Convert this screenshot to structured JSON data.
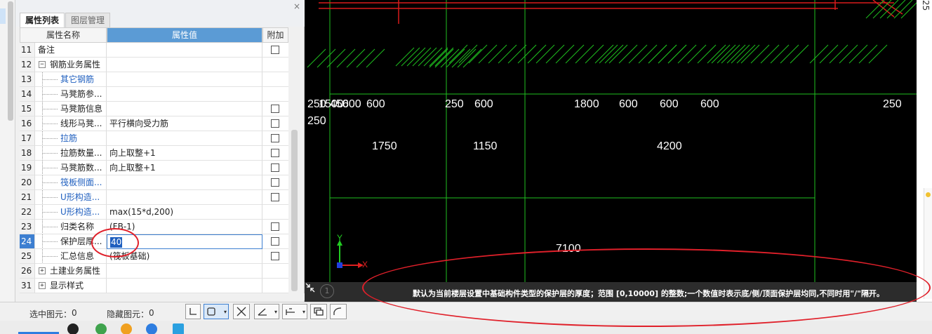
{
  "panel": {
    "close_glyph": "×",
    "tabs": [
      {
        "label": "属性列表",
        "active": true
      },
      {
        "label": "图层管理",
        "active": false
      }
    ],
    "columns": {
      "name": "属性名称",
      "value": "属性值",
      "extra": "附加"
    },
    "rows": [
      {
        "no": "11",
        "name": "备注",
        "value": "",
        "checkbox": true
      },
      {
        "no": "12",
        "name": "钢筋业务属性",
        "value": "",
        "checkbox": false,
        "expander": "−"
      },
      {
        "no": "13",
        "name": "其它钢筋",
        "value": "",
        "checkbox": false,
        "blue": true
      },
      {
        "no": "14",
        "name": "马凳筋参...",
        "value": "",
        "checkbox": false
      },
      {
        "no": "15",
        "name": "马凳筋信息",
        "value": "",
        "checkbox": true
      },
      {
        "no": "16",
        "name": "线形马凳...",
        "value": "平行横向受力筋",
        "checkbox": true
      },
      {
        "no": "17",
        "name": "拉筋",
        "value": "",
        "checkbox": true,
        "blue": true
      },
      {
        "no": "18",
        "name": "拉筋数量...",
        "value": "向上取整+1",
        "checkbox": true
      },
      {
        "no": "19",
        "name": "马凳筋数...",
        "value": "向上取整+1",
        "checkbox": true
      },
      {
        "no": "20",
        "name": "筏板侧面...",
        "value": "",
        "checkbox": true,
        "blue": true
      },
      {
        "no": "21",
        "name": "U形构造...",
        "value": "",
        "checkbox": true,
        "blue": true
      },
      {
        "no": "22",
        "name": "U形构造...",
        "value": "max(15*d,200)",
        "checkbox": false,
        "blue": true
      },
      {
        "no": "23",
        "name": "归类名称",
        "value": "(FB-1)",
        "checkbox": true
      },
      {
        "no": "24",
        "name": "保护层厚...",
        "value": "40",
        "checkbox": true,
        "active": true
      },
      {
        "no": "25",
        "name": "汇总信息",
        "value": "(筏板基础)",
        "checkbox": true
      },
      {
        "no": "26",
        "name": "土建业务属性",
        "value": "",
        "checkbox": false,
        "expander": "+"
      },
      {
        "no": "31",
        "name": "显示样式",
        "value": "",
        "checkbox": false,
        "expander": "+"
      }
    ]
  },
  "canvas": {
    "dims_row1": [
      {
        "text": "250"
      },
      {
        "text": "1500"
      },
      {
        "text": "450"
      },
      {
        "text": "600"
      },
      {
        "text": "600"
      },
      {
        "text": "250"
      },
      {
        "text": "600"
      },
      {
        "text": "1800"
      },
      {
        "text": "600"
      },
      {
        "text": "600"
      },
      {
        "text": "600"
      },
      {
        "text": "250"
      },
      {
        "text": "250"
      }
    ],
    "dims_row2": [
      {
        "text": "1750"
      },
      {
        "text": "1150"
      },
      {
        "text": "4200"
      }
    ],
    "dim_bottom": "7100",
    "axis_x": "X",
    "axis_y": "Y",
    "view_number": "1",
    "status_message": "默认为当前楼层设置中基础构件类型的保护层的厚度；范围 [0,10000] 的整数;一个数值时表示底/侧/顶面保护层均同,不同时用\"/\"隔开。",
    "colors": {
      "grid": "#1fbf1f",
      "rebar": "#d81b1b",
      "axis_y": "#22cc22",
      "axis_x": "#e02020"
    }
  },
  "right_edge": {
    "glyph": "25"
  },
  "bottom": {
    "selected_label": "选中图元：",
    "selected_count": "0",
    "hidden_label": "隐藏图元：",
    "hidden_count": "0",
    "tools": [
      "corner-select-icon",
      "rect-select-icon",
      "cross-select-icon",
      "angle-icon",
      "dimension-icon",
      "layer-icon",
      "arc-icon"
    ]
  },
  "annotation_color": "#e0202a"
}
